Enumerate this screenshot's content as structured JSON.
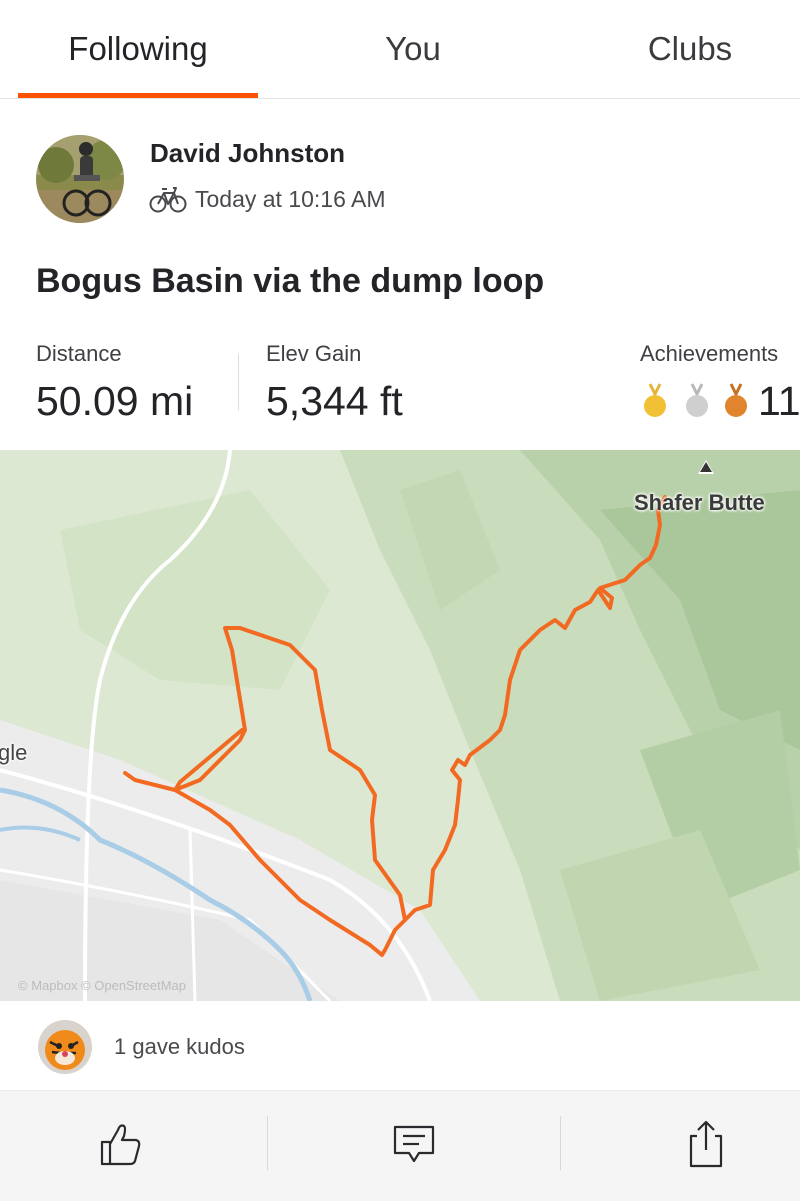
{
  "tabs": [
    {
      "label": "Following",
      "active": true
    },
    {
      "label": "You",
      "active": false
    },
    {
      "label": "Clubs",
      "active": false
    }
  ],
  "colors": {
    "accent": "#fc5200",
    "route": "#f26a22"
  },
  "activity": {
    "athlete": "David Johnston",
    "type_icon": "bike-icon",
    "timestamp": "Today at 10:16 AM",
    "title": "Bogus Basin via the dump loop",
    "stats": {
      "distance_label": "Distance",
      "distance_value": "50.09 mi",
      "elev_label": "Elev Gain",
      "elev_value": "5,344 ft",
      "achievements_label": "Achievements",
      "achievements_count": "11",
      "medals": [
        "gold",
        "silver",
        "bronze"
      ]
    }
  },
  "map": {
    "peak_label": "Shafer Butte",
    "town_label_partial": "gle",
    "attribution": "© Mapbox © OpenStreetMap"
  },
  "kudos": {
    "text": "1 gave kudos"
  },
  "actions": [
    {
      "name": "kudos",
      "icon": "thumbs-up-icon"
    },
    {
      "name": "comment",
      "icon": "comment-icon"
    },
    {
      "name": "share",
      "icon": "share-icon"
    }
  ]
}
